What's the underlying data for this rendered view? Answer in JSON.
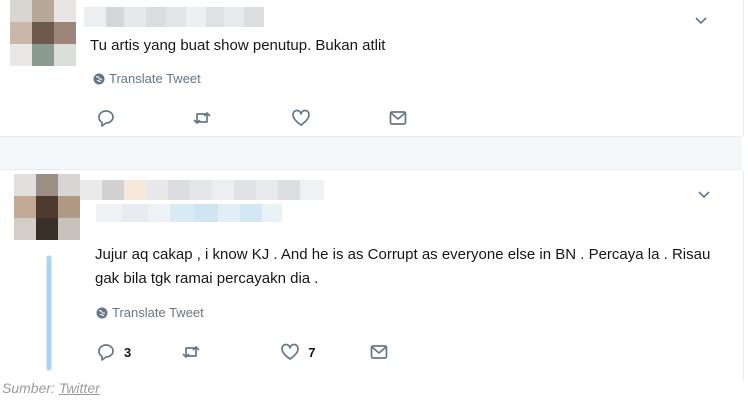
{
  "tweets": [
    {
      "text": "Tu artis yang buat show penutup. Bukan atlit",
      "translate_label": "Translate Tweet",
      "reply_count": "",
      "like_count": ""
    },
    {
      "text": "Jujur aq cakap , i know KJ . And he is as Corrupt as everyone else in BN . Percaya la . Risau gak bila tgk ramai percayakn dia .",
      "translate_label": "Translate Tweet",
      "reply_count": "3",
      "like_count": "7"
    }
  ],
  "caption": {
    "prefix": "Sumber: ",
    "link": "Twitter"
  },
  "colors": {
    "icon": "#657786",
    "thread": "#a7d4f2",
    "text": "#14171a"
  },
  "icons": [
    "globe-icon",
    "reply-icon",
    "retweet-icon",
    "like-icon",
    "dm-icon",
    "chevron-down-icon"
  ]
}
